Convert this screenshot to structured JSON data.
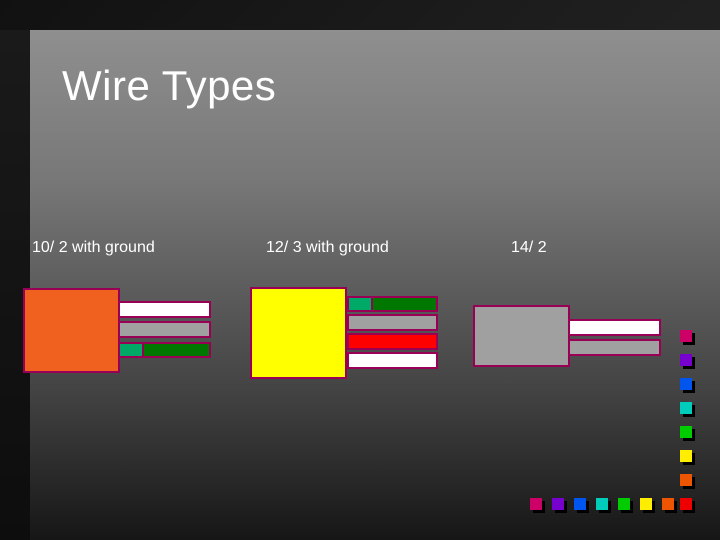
{
  "slide": {
    "title": "Wire Types",
    "cables": [
      {
        "label": "10/ 2 with ground",
        "sheath_color": "#f0601e",
        "wire_colors": [
          "#ffffff",
          "#a0a0a0",
          "#00aa66",
          "#007700"
        ]
      },
      {
        "label": "12/ 3 with ground",
        "sheath_color": "#ffff00",
        "wire_colors": [
          "#00aa66",
          "#007700",
          "#a0a0a0",
          "#ff0000",
          "#ffffff"
        ]
      },
      {
        "label": "14/ 2",
        "sheath_color": "#a0a0a0",
        "wire_colors": [
          "#ffffff",
          "#a0a0a0"
        ]
      }
    ],
    "accent_border_color": "#990055",
    "decor_colors": [
      "#cc0066",
      "#7700cc",
      "#0055ee",
      "#00ccbb",
      "#00cc00",
      "#ffee00",
      "#ee5500",
      "#ee0000"
    ]
  }
}
